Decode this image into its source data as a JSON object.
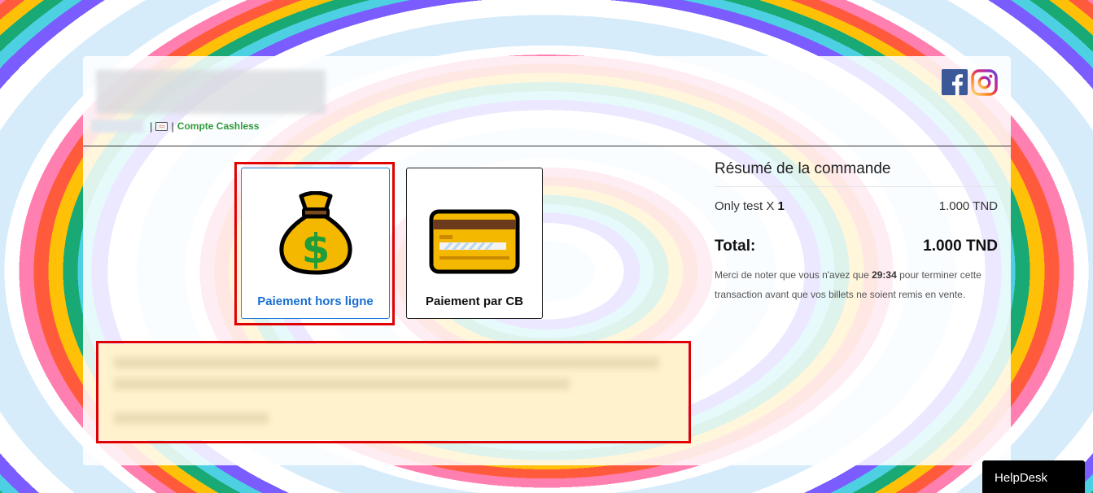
{
  "header": {
    "separator_1": "|",
    "separator_2": "|",
    "cashless_label": "Compte Cashless"
  },
  "social": {
    "facebook_icon": "facebook-icon",
    "instagram_icon": "instagram-icon"
  },
  "payment_options": {
    "offline_label": "Paiement hors ligne",
    "cb_label": "Paiement par CB",
    "offline_icon": "money-bag-icon",
    "cb_icon": "credit-card-icon"
  },
  "summary": {
    "title": "Résumé de la commande",
    "item_name": "Only test X ",
    "item_qty": "1",
    "item_price": "1.000 TND",
    "total_label": "Total:",
    "total_value": "1.000 TND",
    "notice_before": "Merci de noter que vous n'avez que ",
    "notice_time": "29:34",
    "notice_after": " pour terminer cette transaction avant que vos billets ne soient remis en vente."
  },
  "helpdesk": {
    "label": "HelpDesk"
  },
  "colors": {
    "highlight_red": "#e00000",
    "offline_blue": "#1a6fd1",
    "cashless_green": "#2e9a3a",
    "info_bg": "#fff2cc"
  }
}
